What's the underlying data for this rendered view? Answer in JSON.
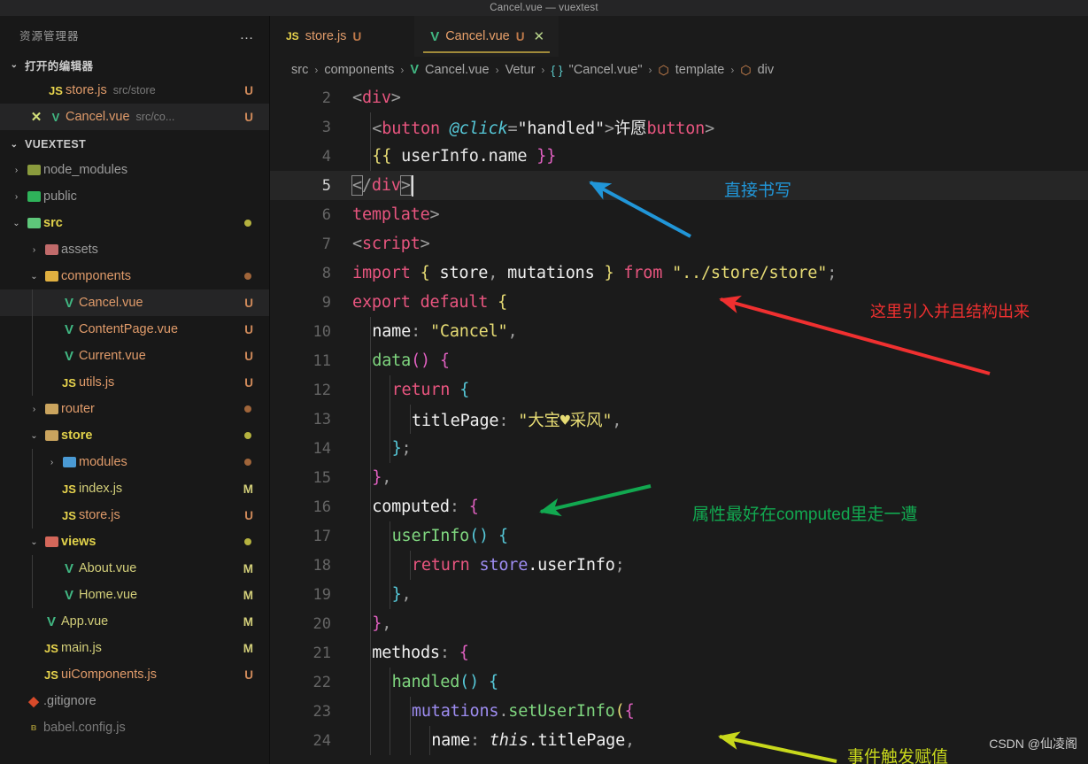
{
  "window": {
    "title": "Cancel.vue — vuextest"
  },
  "sidebar": {
    "title": "资源管理器",
    "more_icon": "…",
    "open_editors": {
      "label": "打开的编辑器",
      "items": [
        {
          "icon": "js-icon",
          "name": "store.js",
          "path": "src/store",
          "badge": "U",
          "close": ""
        },
        {
          "icon": "vue-icon",
          "name": "Cancel.vue",
          "path": "src/co...",
          "badge": "U",
          "close": "✕"
        }
      ]
    },
    "project": {
      "label": "VUEXTEST",
      "items": [
        {
          "depth": 1,
          "twisty": "›",
          "icon": "folder-node-modules-icon",
          "glyph": "📦",
          "name": "node_modules",
          "badge": "",
          "dot": ""
        },
        {
          "depth": 1,
          "twisty": "›",
          "icon": "folder-public-icon",
          "glyph": "📂",
          "name": "public",
          "badge": "",
          "dot": ""
        },
        {
          "depth": 1,
          "twisty": "⌄",
          "icon": "folder-src-icon",
          "glyph": "📂",
          "name": "src",
          "badge": "",
          "dot": "#b5b23f"
        },
        {
          "depth": 2,
          "twisty": "›",
          "icon": "folder-assets-icon",
          "glyph": "🗂",
          "name": "assets",
          "badge": "",
          "dot": ""
        },
        {
          "depth": 2,
          "twisty": "⌄",
          "icon": "folder-components-icon",
          "glyph": "📁",
          "name": "components",
          "badge": "",
          "dot": "#a0653a"
        },
        {
          "depth": 3,
          "twisty": "",
          "icon": "vue-icon",
          "glyph": "V",
          "name": "Cancel.vue",
          "badge": "U",
          "dot": ""
        },
        {
          "depth": 3,
          "twisty": "",
          "icon": "vue-icon",
          "glyph": "V",
          "name": "ContentPage.vue",
          "badge": "U",
          "dot": ""
        },
        {
          "depth": 3,
          "twisty": "",
          "icon": "vue-icon",
          "glyph": "V",
          "name": "Current.vue",
          "badge": "U",
          "dot": ""
        },
        {
          "depth": 3,
          "twisty": "",
          "icon": "js-icon",
          "glyph": "JS",
          "name": "utils.js",
          "badge": "U",
          "dot": ""
        },
        {
          "depth": 2,
          "twisty": "›",
          "icon": "folder-router-icon",
          "glyph": "📁",
          "name": "router",
          "badge": "",
          "dot": "#a0653a"
        },
        {
          "depth": 2,
          "twisty": "⌄",
          "icon": "folder-store-icon",
          "glyph": "📁",
          "name": "store",
          "badge": "",
          "dot": "#b5b23f"
        },
        {
          "depth": 3,
          "twisty": "›",
          "icon": "folder-modules-icon",
          "glyph": "🗃",
          "name": "modules",
          "badge": "",
          "dot": "#a0653a"
        },
        {
          "depth": 3,
          "twisty": "",
          "icon": "js-icon",
          "glyph": "JS",
          "name": "index.js",
          "badge": "M",
          "dot": ""
        },
        {
          "depth": 3,
          "twisty": "",
          "icon": "js-icon",
          "glyph": "JS",
          "name": "store.js",
          "badge": "U",
          "dot": ""
        },
        {
          "depth": 2,
          "twisty": "⌄",
          "icon": "folder-views-icon",
          "glyph": "📁",
          "name": "views",
          "badge": "",
          "dot": "#b5b23f"
        },
        {
          "depth": 3,
          "twisty": "",
          "icon": "vue-icon",
          "glyph": "V",
          "name": "About.vue",
          "badge": "M",
          "dot": ""
        },
        {
          "depth": 3,
          "twisty": "",
          "icon": "vue-icon",
          "glyph": "V",
          "name": "Home.vue",
          "badge": "M",
          "dot": ""
        },
        {
          "depth": 2,
          "twisty": "",
          "icon": "vue-icon",
          "glyph": "V",
          "name": "App.vue",
          "badge": "M",
          "dot": ""
        },
        {
          "depth": 2,
          "twisty": "",
          "icon": "js-icon",
          "glyph": "JS",
          "name": "main.js",
          "badge": "M",
          "dot": ""
        },
        {
          "depth": 2,
          "twisty": "",
          "icon": "js-icon",
          "glyph": "JS",
          "name": "uiComponents.js",
          "badge": "U",
          "dot": ""
        },
        {
          "depth": 1,
          "twisty": "",
          "icon": "git-icon",
          "glyph": "◆",
          "name": ".gitignore",
          "badge": "",
          "dot": ""
        },
        {
          "depth": 1,
          "twisty": "",
          "icon": "babel-icon",
          "glyph": "ʙ",
          "name": "babel.config.js",
          "badge": "",
          "dot": ""
        }
      ]
    }
  },
  "editor": {
    "tabs": [
      {
        "icon": "js-icon",
        "label": "store.js",
        "dirty": "U",
        "active": false,
        "close": ""
      },
      {
        "icon": "vue-icon",
        "label": "Cancel.vue",
        "dirty": "U",
        "active": true,
        "close": "✕"
      }
    ],
    "breadcrumb": [
      {
        "icon": "",
        "label": "src"
      },
      {
        "icon": "",
        "label": "components"
      },
      {
        "icon": "vue-icon",
        "label": "Cancel.vue"
      },
      {
        "icon": "",
        "label": "Vetur"
      },
      {
        "icon": "brace-icon",
        "label": "\"Cancel.vue\""
      },
      {
        "icon": "cube-icon",
        "label": "template"
      },
      {
        "icon": "cube-icon",
        "label": "div"
      }
    ],
    "separator": "›",
    "cursor_line": 5,
    "lines": [
      {
        "n": 2,
        "indent": 0
      },
      {
        "n": 3,
        "indent": 1
      },
      {
        "n": 4,
        "indent": 1
      },
      {
        "n": 5,
        "indent": 0
      },
      {
        "n": 6,
        "indent": 0
      },
      {
        "n": 7,
        "indent": 0
      },
      {
        "n": 8,
        "indent": 0
      },
      {
        "n": 9,
        "indent": 0
      },
      {
        "n": 10,
        "indent": 1
      },
      {
        "n": 11,
        "indent": 1
      },
      {
        "n": 12,
        "indent": 2
      },
      {
        "n": 13,
        "indent": 3
      },
      {
        "n": 14,
        "indent": 2
      },
      {
        "n": 15,
        "indent": 1
      },
      {
        "n": 16,
        "indent": 1
      },
      {
        "n": 17,
        "indent": 2
      },
      {
        "n": 18,
        "indent": 3
      },
      {
        "n": 19,
        "indent": 2
      },
      {
        "n": 20,
        "indent": 1
      },
      {
        "n": 21,
        "indent": 1
      },
      {
        "n": 22,
        "indent": 2
      },
      {
        "n": 23,
        "indent": 3
      },
      {
        "n": 24,
        "indent": 4
      }
    ],
    "code": {
      "l2": "  <div>",
      "l3": "    <button @click=\"handled\">许愿</button>",
      "l4": "    {{ userInfo.name }}",
      "l5": "  </div>",
      "l6": "</template>",
      "l7": "<script>",
      "l8": "import { store, mutations } from \"../store/store\";",
      "l9": "export default {",
      "l10": "  name: \"Cancel\",",
      "l11": "  data() {",
      "l12": "    return {",
      "l13": "      titlePage: \"大宝♥采风\",",
      "l14": "    };",
      "l15": "  },",
      "l16": "  computed: {",
      "l17": "    userInfo() {",
      "l18": "      return store.userInfo;",
      "l19": "    },",
      "l20": "  },",
      "l21": "  methods: {",
      "l22": "    handled() {",
      "l23": "      mutations.setUserInfo({",
      "l24": "        name: this.titlePage,"
    },
    "tokens": {
      "lt": "<",
      "gt": ">",
      "slash": "/",
      "div": "div",
      "button": "button",
      "template": "template",
      "script": "script",
      "at_click": "@click",
      "eq": "=",
      "quote": "\"",
      "handled_str": "handled",
      "xuyuan": "许愿",
      "mustache_open": "{{",
      "mustache_close": "}}",
      "userinfo_name": " userInfo.name ",
      "kw_import": "import",
      "kw_from": "from",
      "kw_export": "export",
      "kw_default": "default",
      "kw_return": "return",
      "brace_open": "{",
      "brace_close": "}",
      "store": "store",
      "comma": ",",
      "mutations": "mutations",
      "path_str": "../store/store",
      "semi": ";",
      "name_key": "name",
      "colon": ":",
      "cancel_str": "Cancel",
      "data_fn": "data",
      "parens": "()",
      "titlepage_key": "titlePage",
      "titlepage_str": "大宝♥采风",
      "computed_key": "computed",
      "userinfo_fn": "userInfo",
      "store_obj": "store",
      "dot_userinfo": ".userInfo",
      "methods_key": "methods",
      "handled_fn": "handled",
      "mutations_obj": "mutations",
      "dot": ".",
      "setuserinfo_fn": "setUserInfo",
      "paren_open": "(",
      "this_kw": "this",
      "dot_titlepage": ".titlePage"
    }
  },
  "annotations": [
    {
      "id": "anno-direct-write",
      "text": "直接书写",
      "color": "#2196d8"
    },
    {
      "id": "anno-import",
      "text": "这里引入并且结构出来",
      "color": "#f03030"
    },
    {
      "id": "anno-computed",
      "text": "属性最好在computed里走一遭",
      "color": "#12a850"
    },
    {
      "id": "anno-event-assign",
      "text": "事件触发赋值",
      "color": "#c8d81c"
    }
  ],
  "watermark": {
    "text": "CSDN @仙凌阁"
  }
}
